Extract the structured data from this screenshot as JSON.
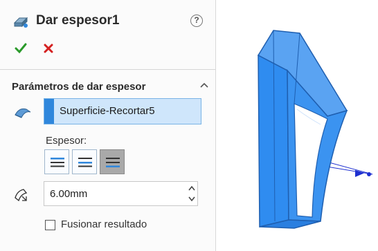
{
  "feature": {
    "title": "Dar espesor1",
    "icon": "thicken-feature-icon",
    "help_symbol": "?"
  },
  "actions": {
    "ok_icon": "checkmark-icon",
    "cancel_icon": "x-icon"
  },
  "section": {
    "title": "Parámetros de dar espesor",
    "collapse_icon": "chevron-up-icon"
  },
  "selection": {
    "value": "Superficie-Recortar5",
    "icon": "surface-face-icon"
  },
  "thickness_side": {
    "label": "Espesor:",
    "options": [
      "side-1",
      "both-sides",
      "side-2"
    ],
    "selected": "side-2"
  },
  "thickness": {
    "value": "6.00mm",
    "icon": "thickness-icon"
  },
  "merge": {
    "label": "Fusionar resultado",
    "checked": false
  },
  "colors": {
    "accent": "#2f87dc",
    "ok": "#2a9a2a",
    "cancel": "#d42020",
    "model": "#2f8cf0"
  }
}
